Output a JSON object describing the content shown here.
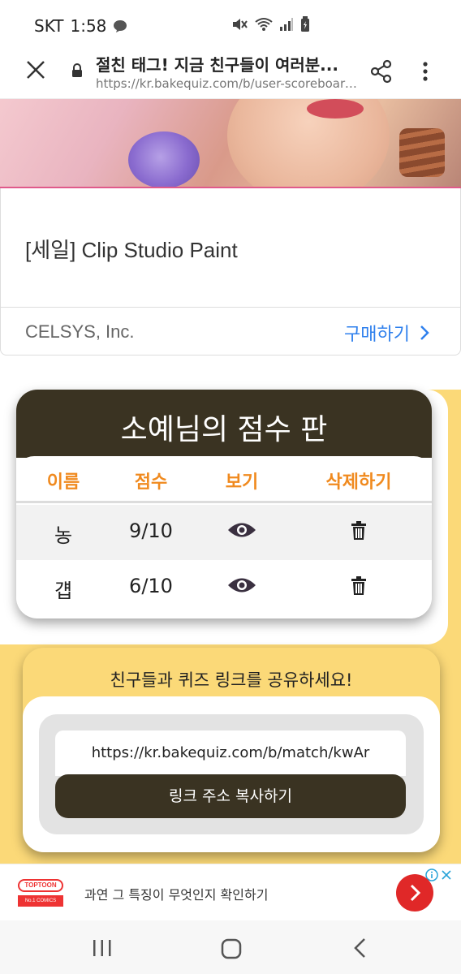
{
  "status_bar": {
    "carrier": "SKT",
    "time": "1:58",
    "icons": [
      "chat-icon",
      "mute-icon",
      "wifi-icon",
      "signal-icon",
      "battery-icon"
    ]
  },
  "browser": {
    "title": "절친 태그! 지금 친구들이 여러분...",
    "url": "https://kr.bakequiz.com/b/user-scoreboard/k..."
  },
  "ad": {
    "title": "[세일] Clip Studio Paint",
    "company": "CELSYS, Inc.",
    "buy_label": "구매하기"
  },
  "scoreboard": {
    "title": "소예님의 점수 판",
    "columns": [
      "이름",
      "점수",
      "보기",
      "삭제하기"
    ],
    "rows": [
      {
        "name": "농",
        "score": "9/10"
      },
      {
        "name": "걥",
        "score": "6/10"
      }
    ]
  },
  "share": {
    "heading": "친구들과 퀴즈 링크를 공유하세요!",
    "link": "https://kr.bakequiz.com/b/match/kwAr",
    "copy_label": "링크 주소 복사하기"
  },
  "bottom_ad": {
    "brand": "TOPTOON",
    "brand_sub": "No.1 COMICS",
    "text": "과연 그 특징이 무엇인지 확인하기"
  },
  "colors": {
    "accent_orange": "#f08a1f",
    "dark_brown": "#3a3322",
    "yellow": "#fbd978",
    "link_blue": "#2f80ed"
  }
}
